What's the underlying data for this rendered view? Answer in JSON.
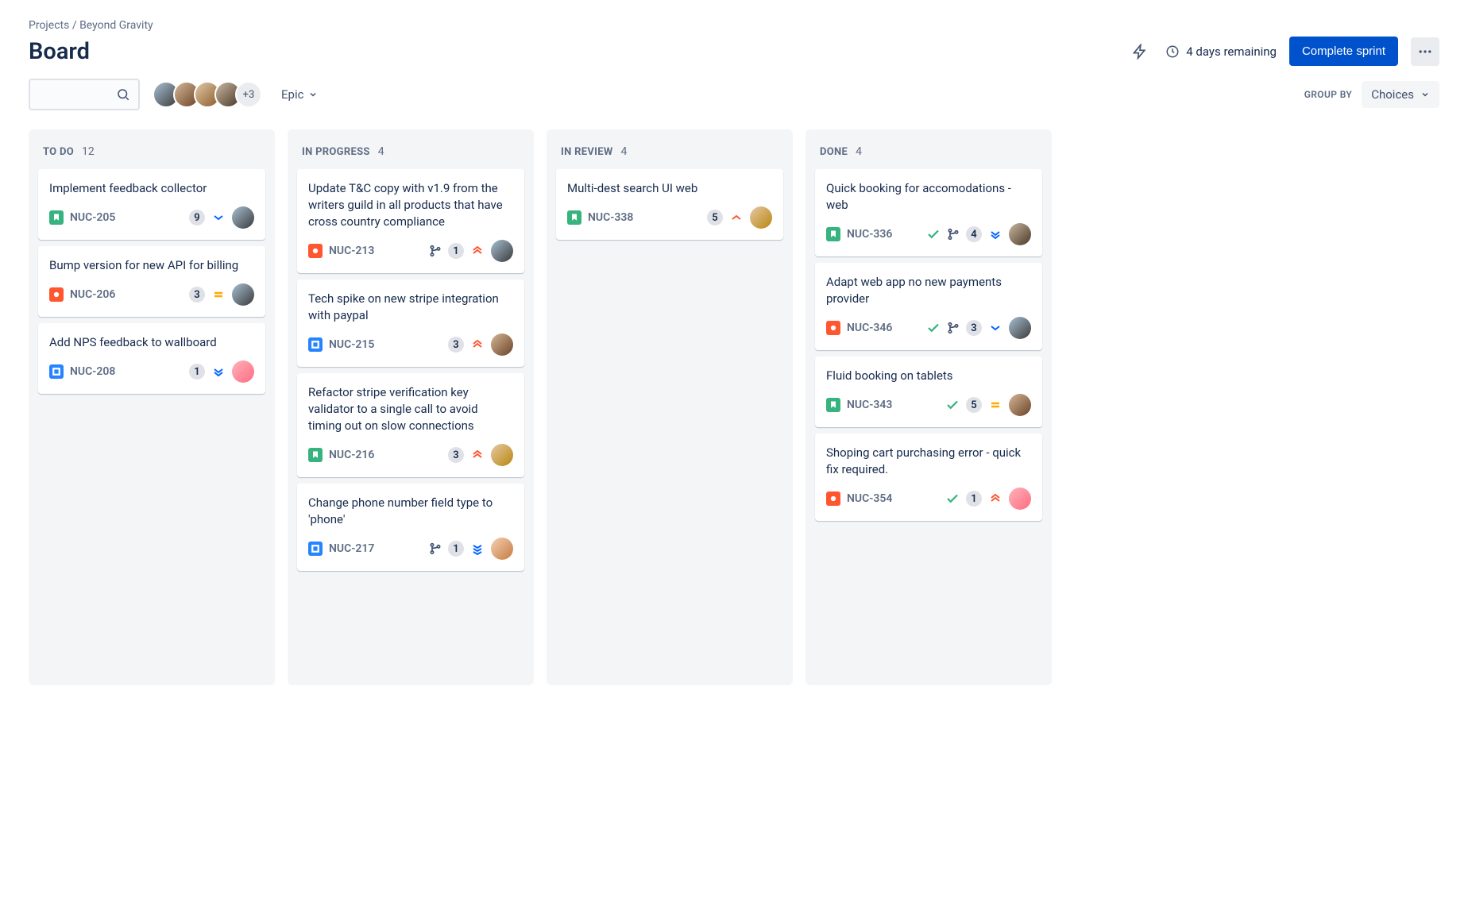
{
  "breadcrumb": {
    "root": "Projects",
    "project": "Beyond Gravity"
  },
  "page": {
    "title": "Board"
  },
  "header": {
    "remaining": "4 days remaining",
    "complete_btn": "Complete sprint"
  },
  "toolbar": {
    "search_placeholder": "",
    "avatar_overflow": "+3",
    "epic_label": "Epic",
    "groupby_label": "GROUP BY",
    "choices_label": "Choices"
  },
  "columns": [
    {
      "id": "todo",
      "title": "TO DO",
      "count": "12"
    },
    {
      "id": "inprog",
      "title": "IN PROGRESS",
      "count": "4"
    },
    {
      "id": "review",
      "title": "IN REVIEW",
      "count": "4"
    },
    {
      "id": "done",
      "title": "DONE",
      "count": "4"
    }
  ],
  "cards": {
    "todo": [
      {
        "title": "Implement feedback collector",
        "type": "story",
        "key": "NUC-205",
        "points": "9",
        "priority": "low-down",
        "branch": false,
        "check": false,
        "avatar": "av-1"
      },
      {
        "title": "Bump version for new API for billing",
        "type": "bug",
        "key": "NUC-206",
        "points": "3",
        "priority": "medium",
        "branch": false,
        "check": false,
        "avatar": "av-1"
      },
      {
        "title": "Add NPS feedback to wallboard",
        "type": "task",
        "key": "NUC-208",
        "points": "1",
        "priority": "lowest",
        "branch": false,
        "check": false,
        "avatar": "av-6"
      }
    ],
    "inprog": [
      {
        "title": "Update T&C copy with v1.9 from the writers guild in all products that have cross country compliance",
        "type": "bug",
        "key": "NUC-213",
        "points": "1",
        "priority": "highest",
        "branch": true,
        "check": false,
        "avatar": "av-1"
      },
      {
        "title": "Tech spike on new stripe integration with paypal",
        "type": "task",
        "key": "NUC-215",
        "points": "3",
        "priority": "high",
        "branch": false,
        "check": false,
        "avatar": "av-2"
      },
      {
        "title": "Refactor stripe verification key validator to a single call to avoid timing out on slow connections",
        "type": "story",
        "key": "NUC-216",
        "points": "3",
        "priority": "high",
        "branch": false,
        "check": false,
        "avatar": "av-7"
      },
      {
        "title": "Change phone number field type to 'phone'",
        "type": "task",
        "key": "NUC-217",
        "points": "1",
        "priority": "lowest-blue",
        "branch": true,
        "check": false,
        "avatar": "av-5"
      }
    ],
    "review": [
      {
        "title": "Multi-dest search UI web",
        "type": "story",
        "key": "NUC-338",
        "points": "5",
        "priority": "high-single",
        "branch": false,
        "check": false,
        "avatar": "av-7"
      }
    ],
    "done": [
      {
        "title": "Quick booking for accomodations - web",
        "type": "story",
        "key": "NUC-336",
        "points": "4",
        "priority": "lowest",
        "branch": true,
        "check": true,
        "avatar": "av-4"
      },
      {
        "title": "Adapt web app no new payments provider",
        "type": "bug",
        "key": "NUC-346",
        "points": "3",
        "priority": "low-down",
        "branch": true,
        "check": true,
        "avatar": "av-1"
      },
      {
        "title": "Fluid booking on tablets",
        "type": "story",
        "key": "NUC-343",
        "points": "5",
        "priority": "medium",
        "branch": false,
        "check": true,
        "avatar": "av-2"
      },
      {
        "title": "Shoping cart purchasing error - quick fix required.",
        "type": "bug",
        "key": "NUC-354",
        "points": "1",
        "priority": "highest",
        "branch": false,
        "check": true,
        "avatar": "av-6"
      }
    ]
  }
}
